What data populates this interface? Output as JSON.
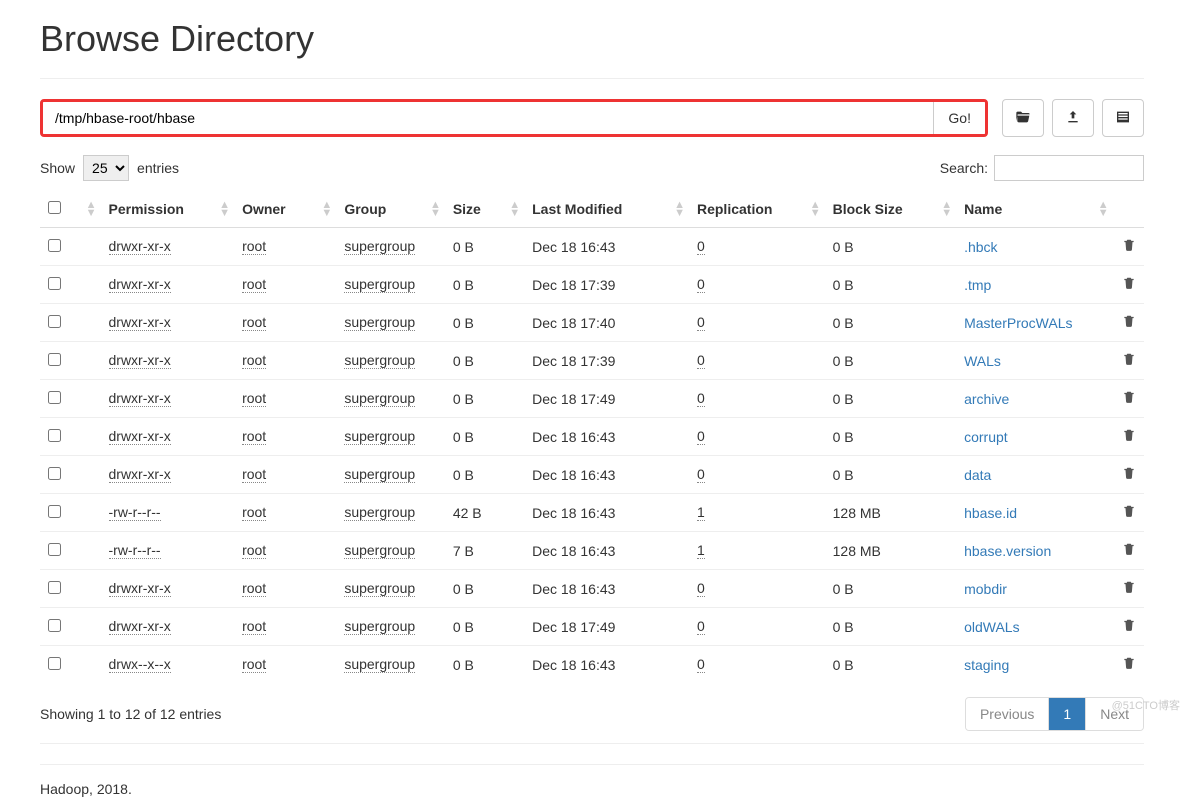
{
  "page": {
    "title": "Browse Directory",
    "footer": "Hadoop, 2018.",
    "watermark": "@51CTO博客"
  },
  "path": {
    "value": "/tmp/hbase-root/hbase",
    "go_label": "Go!"
  },
  "controls": {
    "show_prefix": "Show",
    "show_suffix": "entries",
    "show_value": "25",
    "search_label": "Search:",
    "search_value": "",
    "info": "Showing 1 to 12 of 12 entries",
    "prev": "Previous",
    "page_current": "1",
    "next": "Next"
  },
  "columns": {
    "permission": "Permission",
    "owner": "Owner",
    "group": "Group",
    "size": "Size",
    "modified": "Last Modified",
    "replication": "Replication",
    "block": "Block Size",
    "name": "Name"
  },
  "rows": [
    {
      "perm": "drwxr-xr-x",
      "owner": "root",
      "group": "supergroup",
      "size": "0 B",
      "mod": "Dec 18 16:43",
      "repl": "0",
      "block": "0 B",
      "name": ".hbck"
    },
    {
      "perm": "drwxr-xr-x",
      "owner": "root",
      "group": "supergroup",
      "size": "0 B",
      "mod": "Dec 18 17:39",
      "repl": "0",
      "block": "0 B",
      "name": ".tmp"
    },
    {
      "perm": "drwxr-xr-x",
      "owner": "root",
      "group": "supergroup",
      "size": "0 B",
      "mod": "Dec 18 17:40",
      "repl": "0",
      "block": "0 B",
      "name": "MasterProcWALs"
    },
    {
      "perm": "drwxr-xr-x",
      "owner": "root",
      "group": "supergroup",
      "size": "0 B",
      "mod": "Dec 18 17:39",
      "repl": "0",
      "block": "0 B",
      "name": "WALs"
    },
    {
      "perm": "drwxr-xr-x",
      "owner": "root",
      "group": "supergroup",
      "size": "0 B",
      "mod": "Dec 18 17:49",
      "repl": "0",
      "block": "0 B",
      "name": "archive"
    },
    {
      "perm": "drwxr-xr-x",
      "owner": "root",
      "group": "supergroup",
      "size": "0 B",
      "mod": "Dec 18 16:43",
      "repl": "0",
      "block": "0 B",
      "name": "corrupt"
    },
    {
      "perm": "drwxr-xr-x",
      "owner": "root",
      "group": "supergroup",
      "size": "0 B",
      "mod": "Dec 18 16:43",
      "repl": "0",
      "block": "0 B",
      "name": "data"
    },
    {
      "perm": "-rw-r--r--",
      "owner": "root",
      "group": "supergroup",
      "size": "42 B",
      "mod": "Dec 18 16:43",
      "repl": "1",
      "block": "128 MB",
      "name": "hbase.id"
    },
    {
      "perm": "-rw-r--r--",
      "owner": "root",
      "group": "supergroup",
      "size": "7 B",
      "mod": "Dec 18 16:43",
      "repl": "1",
      "block": "128 MB",
      "name": "hbase.version"
    },
    {
      "perm": "drwxr-xr-x",
      "owner": "root",
      "group": "supergroup",
      "size": "0 B",
      "mod": "Dec 18 16:43",
      "repl": "0",
      "block": "0 B",
      "name": "mobdir"
    },
    {
      "perm": "drwxr-xr-x",
      "owner": "root",
      "group": "supergroup",
      "size": "0 B",
      "mod": "Dec 18 17:49",
      "repl": "0",
      "block": "0 B",
      "name": "oldWALs"
    },
    {
      "perm": "drwx--x--x",
      "owner": "root",
      "group": "supergroup",
      "size": "0 B",
      "mod": "Dec 18 16:43",
      "repl": "0",
      "block": "0 B",
      "name": "staging"
    }
  ]
}
